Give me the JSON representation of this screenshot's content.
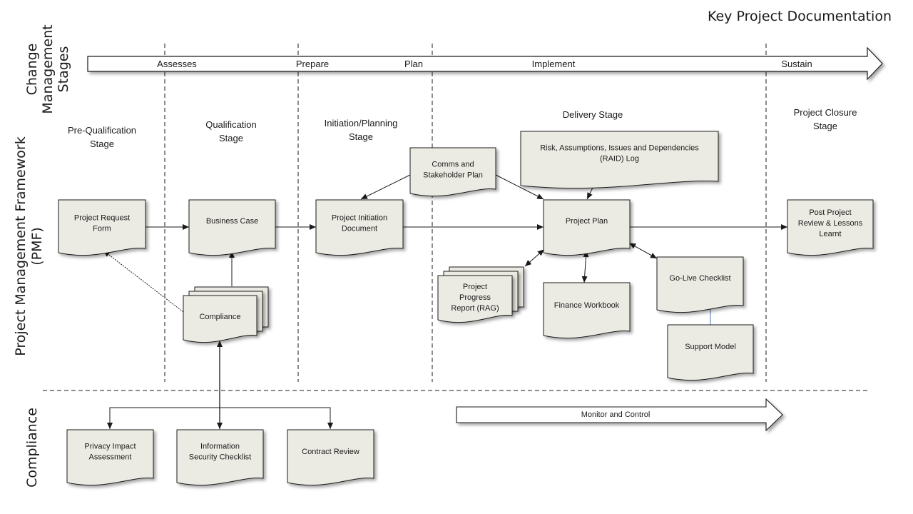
{
  "title": "Key Project Documentation",
  "colors": {
    "doc_fill": "#ecebe3",
    "stroke": "#1a1a1a",
    "connector_blue": "#4a74b0"
  },
  "lanes": {
    "change_management": [
      "Change",
      "Management",
      "Stages"
    ],
    "pmf": [
      "Project Management Framework",
      "(PMF)"
    ],
    "compliance": [
      "Compliance"
    ]
  },
  "change_stages": [
    "Assesses",
    "Prepare",
    "Plan",
    "Implement",
    "Sustain"
  ],
  "pmf_stages": [
    [
      "Pre-Qualification",
      "Stage"
    ],
    [
      "Qualification",
      "Stage"
    ],
    [
      "Initiation/Planning",
      "Stage"
    ],
    [
      "Delivery Stage"
    ],
    [
      "Project Closure",
      "Stage"
    ]
  ],
  "documents": {
    "project_request_form": [
      "Project Request",
      "Form"
    ],
    "business_case": [
      "Business Case"
    ],
    "compliance": [
      "Compliance"
    ],
    "project_initiation_document": [
      "Project Initiation",
      "Document"
    ],
    "comms_stakeholder_plan": [
      "Comms and",
      "Stakeholder Plan"
    ],
    "raid_log": [
      "Risk, Assumptions, Issues and Dependencies",
      "(RAID) Log"
    ],
    "project_plan": [
      "Project Plan"
    ],
    "progress_report": [
      "Project",
      "Progress",
      "Report (RAG)"
    ],
    "finance_workbook": [
      "Finance Workbook"
    ],
    "go_live_checklist": [
      "Go-Live Checklist"
    ],
    "support_model": [
      "Support Model"
    ],
    "post_project_review": [
      "Post Project",
      "Review & Lessons",
      "Learnt"
    ],
    "privacy_impact": [
      "Privacy Impact",
      "Assessment"
    ],
    "info_security": [
      "Information",
      "Security Checklist"
    ],
    "contract_review": [
      "Contract Review"
    ]
  },
  "monitor_control": "Monitor and Control"
}
